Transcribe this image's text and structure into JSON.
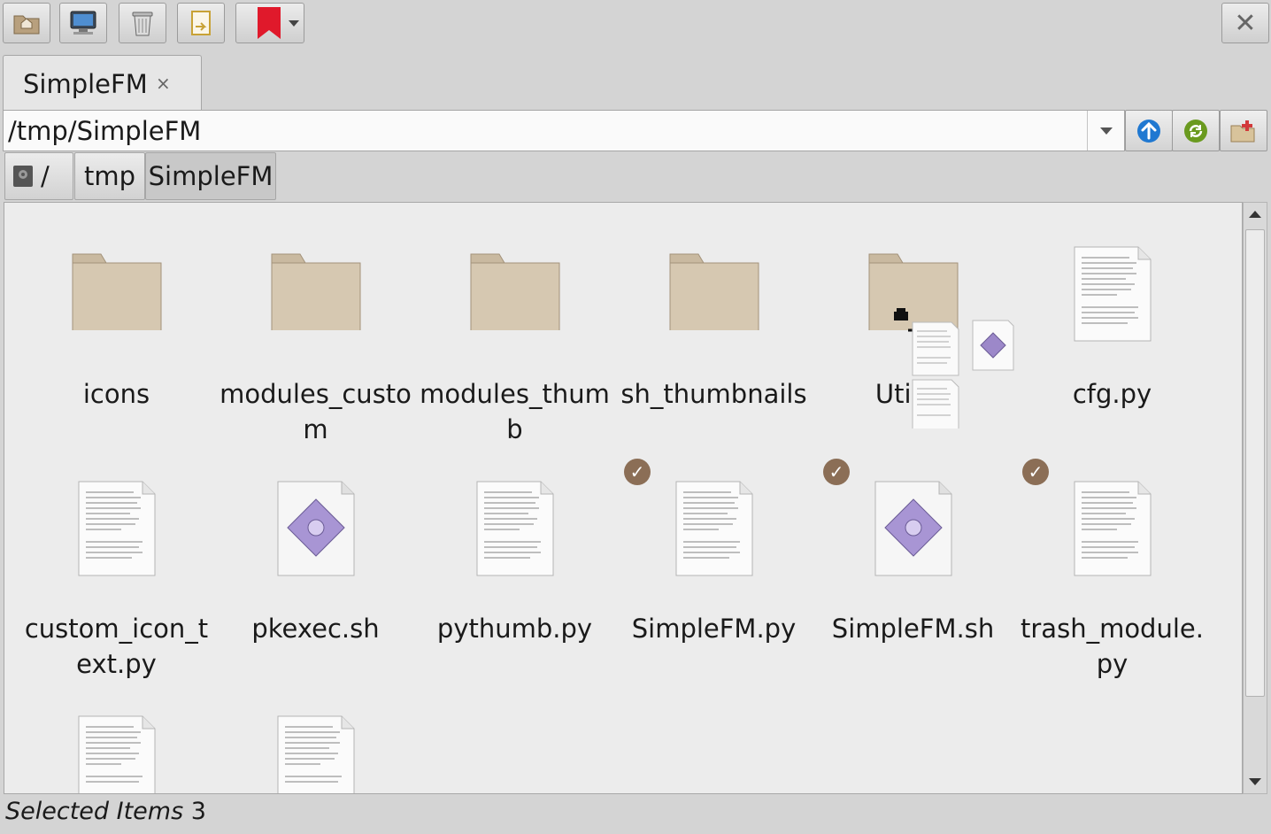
{
  "window": {
    "close_glyph": "✕"
  },
  "toolbar": {
    "buttons": [
      {
        "name": "home-folder-button",
        "icon": "home-folder-icon"
      },
      {
        "name": "computer-button",
        "icon": "computer-icon"
      },
      {
        "name": "trash-button",
        "icon": "trash-icon"
      },
      {
        "name": "move-to-button",
        "icon": "move-to-icon"
      },
      {
        "name": "bookmarks-button",
        "icon": "bookmark-icon"
      }
    ]
  },
  "tabs": [
    {
      "label": "SimpleFM",
      "close": "×"
    }
  ],
  "path": {
    "value": "/tmp/SimpleFM"
  },
  "breadcrumb": {
    "root": "/",
    "items": [
      "tmp",
      "SimpleFM"
    ]
  },
  "files": {
    "row1": [
      {
        "name": "icons",
        "type": "folder"
      },
      {
        "name": "modules_custom",
        "type": "folder"
      },
      {
        "name": "modules_thumb",
        "type": "folder"
      },
      {
        "name": "sh_thumbnails",
        "type": "folder"
      },
      {
        "name": "Utility",
        "type": "folder"
      },
      {
        "name": "cfg.py",
        "type": "text"
      }
    ],
    "row2": [
      {
        "name": "custom_icon_text.py",
        "type": "text",
        "selected": false
      },
      {
        "name": "pkexec.sh",
        "type": "script",
        "selected": false
      },
      {
        "name": "pythumb.py",
        "type": "text",
        "selected": false
      },
      {
        "name": "SimpleFM.py",
        "type": "text",
        "selected": true
      },
      {
        "name": "SimpleFM.sh",
        "type": "script",
        "selected": true
      },
      {
        "name": "trash_module.py",
        "type": "text",
        "selected": true
      }
    ],
    "check_glyph": "✓"
  },
  "status": {
    "label": "Selected Items",
    "count": "3"
  },
  "colors": {
    "folder": "#c9b9a0",
    "check": "#8b6e56",
    "up_arrow": "#1f78d1",
    "refresh": "#6a9a1f"
  }
}
